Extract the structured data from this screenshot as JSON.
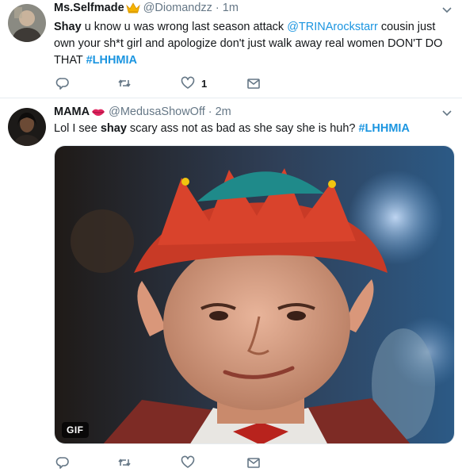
{
  "tweets": [
    {
      "name": "Ms.Selfmade",
      "name_emoji": "crown-icon",
      "handle": "@Diomandzz",
      "separator": "·",
      "time": "1m",
      "text": {
        "part1_bold": "Shay",
        "part2": " u know u was wrong last season attack ",
        "mention": "@TRINArockstarr",
        "part3": " cousin just own your sh*t girl and apologize don't just walk away real women DON'T DO THAT ",
        "hashtag": "#LHHMIA"
      },
      "actions": {
        "reply_count": "",
        "retweet_count": "",
        "like_count": "1"
      }
    },
    {
      "name": "MAMA",
      "name_emoji": "lips-icon",
      "handle": "@MedusaShowOff",
      "separator": "·",
      "time": "2m",
      "text": {
        "part1": "Lol I see ",
        "part1_bold": "shay",
        "part2": " scary ass not as bad as she say she is huh? ",
        "hashtag": "#LHHMIA"
      },
      "media": {
        "type": "gif",
        "badge": "GIF",
        "description_icon": "elf-gif-image"
      }
    }
  ],
  "colors": {
    "link": "#1b95e0",
    "secondary_text": "#657786",
    "icon": "#657786",
    "divider": "#e6ecf0"
  }
}
